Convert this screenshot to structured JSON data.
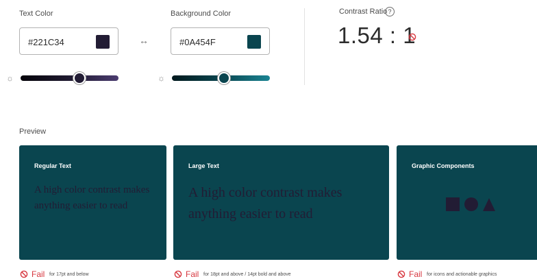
{
  "text_color": {
    "label": "Text Color",
    "value": "#221C34",
    "swatch": "#221C34",
    "slider_level": 0.6
  },
  "background_color": {
    "label": "Background Color",
    "value": "#0A454F",
    "swatch": "#0A454F",
    "slider_level": 0.53
  },
  "swap_icon": "swap-arrows-icon",
  "brightness_icon": "sun-icon",
  "contrast": {
    "label": "Contrast Ratio",
    "help_glyph": "?",
    "value": "1.54 : 1",
    "status_icon": "fail-icon"
  },
  "preview": {
    "label": "Preview",
    "cards": [
      {
        "title": "Regular Text",
        "sample": "A high color contrast makes anything easier to read",
        "result": "Fail",
        "criteria": "for 17pt and below"
      },
      {
        "title": "Large Text",
        "sample": "A high color contrast makes anything easier to read",
        "result": "Fail",
        "criteria": "for 18pt and above / 14pt bold and above"
      },
      {
        "title": "Graphic Components",
        "shapes": [
          "square",
          "circle",
          "triangle"
        ],
        "result": "Fail",
        "criteria": "for icons and actionable graphics"
      }
    ]
  },
  "colors": {
    "fail": "#D7373F",
    "card_bg": "#0A454F",
    "card_fg": "#221C34"
  }
}
